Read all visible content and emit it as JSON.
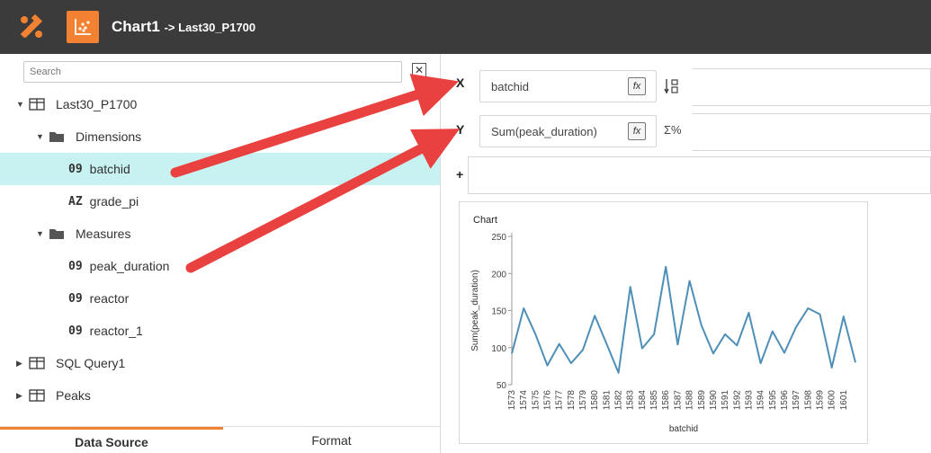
{
  "topbar": {
    "title": "Chart1",
    "path": "-> Last30_P1700",
    "brand_color": "#f28132"
  },
  "search": {
    "placeholder": "Search",
    "close_icon": "close-x-icon"
  },
  "tree": {
    "dataset": "Last30_P1700",
    "dimensions_label": "Dimensions",
    "dimensions": [
      {
        "type": "09",
        "name": "batchid"
      },
      {
        "type": "AZ",
        "name": "grade_pi"
      }
    ],
    "measures_label": "Measures",
    "measures": [
      {
        "type": "09",
        "name": "peak_duration"
      },
      {
        "type": "09",
        "name": "reactor"
      },
      {
        "type": "09",
        "name": "reactor_1"
      }
    ],
    "other_tables": [
      "SQL Query1",
      "Peaks"
    ]
  },
  "tabs": {
    "data_source": "Data Source",
    "format": "Format"
  },
  "shelves": {
    "x_letter": "X",
    "x_field": "batchid",
    "y_letter": "Y",
    "y_field": "Sum(peak_duration)",
    "plus": "+",
    "fx_label": "fx",
    "sort_icon": "↕",
    "sigma_label": "Σ%"
  },
  "annotation_color": "#e8413f",
  "chart_data": {
    "type": "line",
    "title": "Chart",
    "xlabel": "batchid",
    "ylabel": "Sum(peak_duration)",
    "ylim": [
      50,
      250
    ],
    "yticks": [
      50,
      100,
      150,
      200,
      250
    ],
    "line_color": "#4e8fb8",
    "grid": false,
    "x": [
      "1573",
      "1574",
      "1575",
      "1576",
      "1577",
      "1578",
      "1579",
      "1580",
      "1581",
      "1582",
      "1583",
      "1584",
      "1585",
      "1586",
      "1587",
      "1588",
      "1589",
      "1590",
      "1591",
      "1592",
      "1593",
      "1594",
      "1595",
      "1596",
      "1597",
      "1598",
      "1599",
      "1600",
      "1601"
    ],
    "x_extra_points": 1,
    "values": [
      92,
      153,
      118,
      76,
      105,
      79,
      97,
      143,
      105,
      66,
      182,
      99,
      118,
      209,
      104,
      190,
      130,
      92,
      118,
      103,
      147,
      79,
      122,
      93,
      128,
      153,
      145,
      73,
      142,
      80
    ]
  }
}
